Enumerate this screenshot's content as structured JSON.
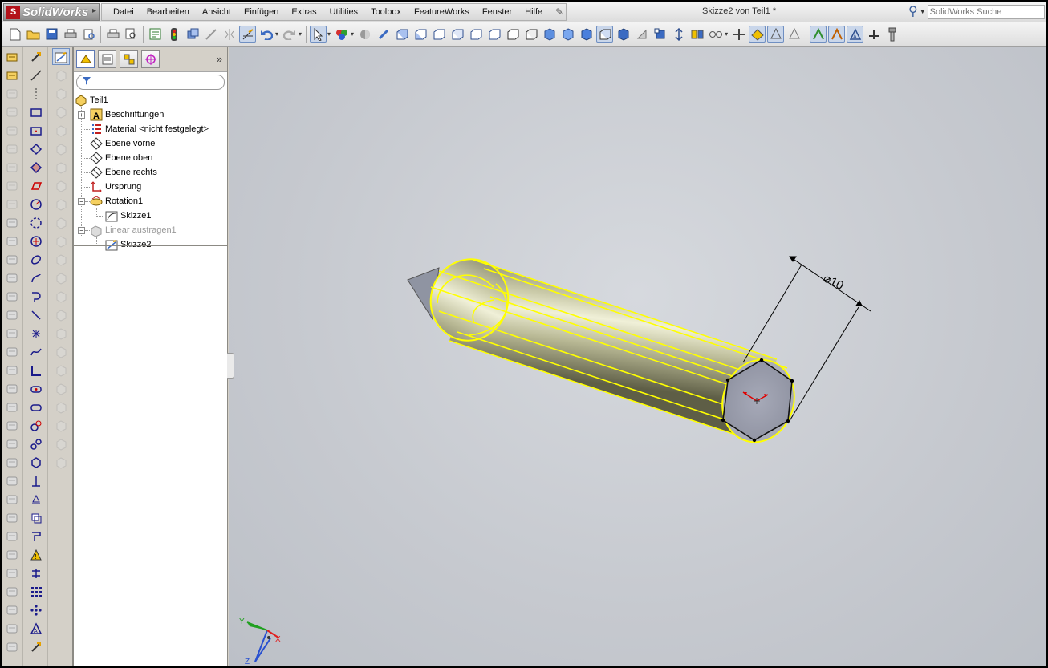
{
  "app": {
    "name": "SolidWorks",
    "document_title": "Skizze2 von Teil1 *",
    "search_placeholder": "SolidWorks Suche"
  },
  "menu": [
    "Datei",
    "Bearbeiten",
    "Ansicht",
    "Einfügen",
    "Extras",
    "Utilities",
    "Toolbox",
    "FeatureWorks",
    "Fenster",
    "Hilfe"
  ],
  "toolbar_icons": [
    "new-document",
    "open",
    "save",
    "print",
    "undo",
    "redo",
    "select",
    "rebuild",
    "options",
    "view-orientation",
    "display-style",
    "section-view",
    "hide-show",
    "edit-appearance",
    "apply-scene",
    "view-settings",
    "zoom-to-fit",
    "zoom-area",
    "rotate"
  ],
  "feature_tree": {
    "root": "Teil1",
    "items": [
      {
        "label": "Beschriftungen",
        "icon": "annotations-icon"
      },
      {
        "label": "Material <nicht festgelegt>",
        "icon": "material-icon"
      },
      {
        "label": "Ebene vorne",
        "icon": "plane-icon"
      },
      {
        "label": "Ebene oben",
        "icon": "plane-icon"
      },
      {
        "label": "Ebene rechts",
        "icon": "plane-icon"
      },
      {
        "label": "Ursprung",
        "icon": "origin-icon"
      },
      {
        "label": "Rotation1",
        "icon": "revolve-icon"
      },
      {
        "label": "Skizze1",
        "icon": "sketch-icon"
      },
      {
        "label": "Linear austragen1",
        "icon": "extrude-icon",
        "dimmed": true
      },
      {
        "label": "Skizze2",
        "icon": "sketch-icon"
      }
    ]
  },
  "viewport": {
    "dimension_label": "⌀10",
    "triad": {
      "x": "X",
      "y": "Y",
      "z": "Z"
    },
    "highlight_color": "#ffff00",
    "selection_color": "#e00000"
  }
}
